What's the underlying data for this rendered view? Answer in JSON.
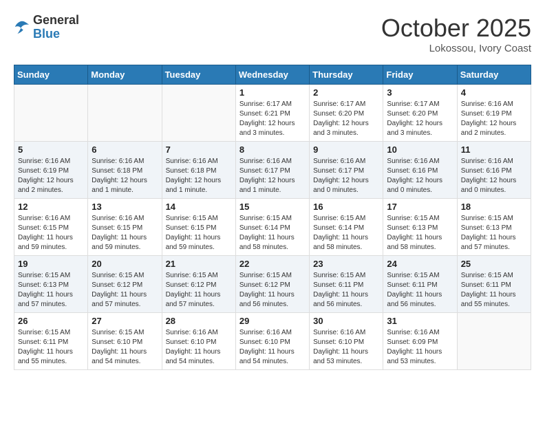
{
  "header": {
    "logo_general": "General",
    "logo_blue": "Blue",
    "month_title": "October 2025",
    "location": "Lokossou, Ivory Coast"
  },
  "weekdays": [
    "Sunday",
    "Monday",
    "Tuesday",
    "Wednesday",
    "Thursday",
    "Friday",
    "Saturday"
  ],
  "weeks": [
    {
      "shaded": false,
      "days": [
        {
          "number": "",
          "info": ""
        },
        {
          "number": "",
          "info": ""
        },
        {
          "number": "",
          "info": ""
        },
        {
          "number": "1",
          "info": "Sunrise: 6:17 AM\nSunset: 6:21 PM\nDaylight: 12 hours\nand 3 minutes."
        },
        {
          "number": "2",
          "info": "Sunrise: 6:17 AM\nSunset: 6:20 PM\nDaylight: 12 hours\nand 3 minutes."
        },
        {
          "number": "3",
          "info": "Sunrise: 6:17 AM\nSunset: 6:20 PM\nDaylight: 12 hours\nand 3 minutes."
        },
        {
          "number": "4",
          "info": "Sunrise: 6:16 AM\nSunset: 6:19 PM\nDaylight: 12 hours\nand 2 minutes."
        }
      ]
    },
    {
      "shaded": true,
      "days": [
        {
          "number": "5",
          "info": "Sunrise: 6:16 AM\nSunset: 6:19 PM\nDaylight: 12 hours\nand 2 minutes."
        },
        {
          "number": "6",
          "info": "Sunrise: 6:16 AM\nSunset: 6:18 PM\nDaylight: 12 hours\nand 1 minute."
        },
        {
          "number": "7",
          "info": "Sunrise: 6:16 AM\nSunset: 6:18 PM\nDaylight: 12 hours\nand 1 minute."
        },
        {
          "number": "8",
          "info": "Sunrise: 6:16 AM\nSunset: 6:17 PM\nDaylight: 12 hours\nand 1 minute."
        },
        {
          "number": "9",
          "info": "Sunrise: 6:16 AM\nSunset: 6:17 PM\nDaylight: 12 hours\nand 0 minutes."
        },
        {
          "number": "10",
          "info": "Sunrise: 6:16 AM\nSunset: 6:16 PM\nDaylight: 12 hours\nand 0 minutes."
        },
        {
          "number": "11",
          "info": "Sunrise: 6:16 AM\nSunset: 6:16 PM\nDaylight: 12 hours\nand 0 minutes."
        }
      ]
    },
    {
      "shaded": false,
      "days": [
        {
          "number": "12",
          "info": "Sunrise: 6:16 AM\nSunset: 6:15 PM\nDaylight: 11 hours\nand 59 minutes."
        },
        {
          "number": "13",
          "info": "Sunrise: 6:16 AM\nSunset: 6:15 PM\nDaylight: 11 hours\nand 59 minutes."
        },
        {
          "number": "14",
          "info": "Sunrise: 6:15 AM\nSunset: 6:15 PM\nDaylight: 11 hours\nand 59 minutes."
        },
        {
          "number": "15",
          "info": "Sunrise: 6:15 AM\nSunset: 6:14 PM\nDaylight: 11 hours\nand 58 minutes."
        },
        {
          "number": "16",
          "info": "Sunrise: 6:15 AM\nSunset: 6:14 PM\nDaylight: 11 hours\nand 58 minutes."
        },
        {
          "number": "17",
          "info": "Sunrise: 6:15 AM\nSunset: 6:13 PM\nDaylight: 11 hours\nand 58 minutes."
        },
        {
          "number": "18",
          "info": "Sunrise: 6:15 AM\nSunset: 6:13 PM\nDaylight: 11 hours\nand 57 minutes."
        }
      ]
    },
    {
      "shaded": true,
      "days": [
        {
          "number": "19",
          "info": "Sunrise: 6:15 AM\nSunset: 6:13 PM\nDaylight: 11 hours\nand 57 minutes."
        },
        {
          "number": "20",
          "info": "Sunrise: 6:15 AM\nSunset: 6:12 PM\nDaylight: 11 hours\nand 57 minutes."
        },
        {
          "number": "21",
          "info": "Sunrise: 6:15 AM\nSunset: 6:12 PM\nDaylight: 11 hours\nand 57 minutes."
        },
        {
          "number": "22",
          "info": "Sunrise: 6:15 AM\nSunset: 6:12 PM\nDaylight: 11 hours\nand 56 minutes."
        },
        {
          "number": "23",
          "info": "Sunrise: 6:15 AM\nSunset: 6:11 PM\nDaylight: 11 hours\nand 56 minutes."
        },
        {
          "number": "24",
          "info": "Sunrise: 6:15 AM\nSunset: 6:11 PM\nDaylight: 11 hours\nand 56 minutes."
        },
        {
          "number": "25",
          "info": "Sunrise: 6:15 AM\nSunset: 6:11 PM\nDaylight: 11 hours\nand 55 minutes."
        }
      ]
    },
    {
      "shaded": false,
      "days": [
        {
          "number": "26",
          "info": "Sunrise: 6:15 AM\nSunset: 6:11 PM\nDaylight: 11 hours\nand 55 minutes."
        },
        {
          "number": "27",
          "info": "Sunrise: 6:15 AM\nSunset: 6:10 PM\nDaylight: 11 hours\nand 54 minutes."
        },
        {
          "number": "28",
          "info": "Sunrise: 6:16 AM\nSunset: 6:10 PM\nDaylight: 11 hours\nand 54 minutes."
        },
        {
          "number": "29",
          "info": "Sunrise: 6:16 AM\nSunset: 6:10 PM\nDaylight: 11 hours\nand 54 minutes."
        },
        {
          "number": "30",
          "info": "Sunrise: 6:16 AM\nSunset: 6:10 PM\nDaylight: 11 hours\nand 53 minutes."
        },
        {
          "number": "31",
          "info": "Sunrise: 6:16 AM\nSunset: 6:09 PM\nDaylight: 11 hours\nand 53 minutes."
        },
        {
          "number": "",
          "info": ""
        }
      ]
    }
  ]
}
